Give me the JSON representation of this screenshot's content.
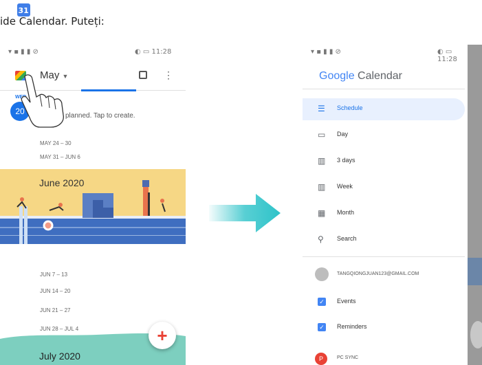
{
  "instruction": {
    "prefix": "ide ",
    "cal_letter": "C",
    "rest": "alendar. Puteți:",
    "app_icon_number": "31"
  },
  "left_phone": {
    "status_time": "11:28",
    "month_label": "May",
    "day_label": "WED",
    "day_number": "20",
    "empty_text": "planned. Tap to create.",
    "week_rows": [
      "MAY 24 – 30",
      "MAY 31 – JUN 6"
    ],
    "banner1_title": "June 2020",
    "june_rows": [
      "JUN 7 – 13",
      "JUN 14 – 20",
      "JUN 21 – 27",
      "JUN 28 – JUL 4"
    ],
    "banner2_title": "July 2020",
    "fab_label": "+"
  },
  "drawer": {
    "status_time": "11:28",
    "logo_google": "Google",
    "logo_calendar": "Calendar",
    "views": [
      {
        "label": "Schedule",
        "icon": "schedule-icon"
      },
      {
        "label": "Day",
        "icon": "day-icon"
      },
      {
        "label": "3 days",
        "icon": "three-days-icon"
      },
      {
        "label": "Week",
        "icon": "week-icon"
      },
      {
        "label": "Month",
        "icon": "month-icon"
      },
      {
        "label": "Search",
        "icon": "search-icon"
      }
    ],
    "account_email": "TANGQIONGJUAN123@GMAIL.COM",
    "calendars": [
      "Events",
      "Reminders"
    ],
    "pc_sync_initial": "P",
    "pc_sync_label": "PC SYNC"
  },
  "colors": {
    "accent": "#1a73e8",
    "banner": "#f6d785",
    "water": "#3f6ec0",
    "arrow": "#2ec3c9",
    "teal_banner": "#7dcfbf"
  }
}
